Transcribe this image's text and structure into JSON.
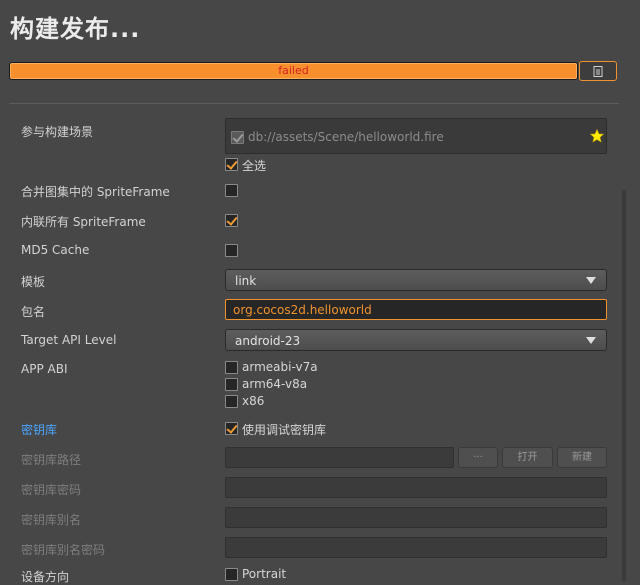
{
  "window": {
    "title": "构建发布..."
  },
  "progress": {
    "status_text": "failed",
    "value": 1.0
  },
  "log_button": {
    "icon": "document-icon"
  },
  "scenes": {
    "label": "参与构建场景",
    "items": [
      {
        "path": "db://assets/Scene/helloworld.fire",
        "checked": true,
        "start_scene": true
      }
    ],
    "select_all_label": "全选"
  },
  "merge_spriteframe": {
    "label": "合并图集中的 SpriteFrame",
    "checked": false
  },
  "inline_spriteframe": {
    "label": "内联所有 SpriteFrame",
    "checked": true
  },
  "md5_cache": {
    "label": "MD5 Cache",
    "checked": false
  },
  "template": {
    "label": "模板",
    "value": "link"
  },
  "package_name": {
    "label": "包名",
    "value": "org.cocos2d.helloworld"
  },
  "api_level": {
    "label": "Target API Level",
    "value": "android-23"
  },
  "app_abi": {
    "label": "APP ABI",
    "options": [
      {
        "name": "armeabi-v7a",
        "checked": false
      },
      {
        "name": "arm64-v8a",
        "checked": false
      },
      {
        "name": "x86",
        "checked": false
      }
    ]
  },
  "keystore": {
    "label": "密钥库",
    "use_debug_label": "使用调试密钥库",
    "use_debug_checked": true,
    "path_label": "密钥库路径",
    "path_value": "",
    "browse_label": "···",
    "open_label": "打开",
    "new_label": "新建",
    "password_label": "密钥库密码",
    "alias_label": "密钥库别名",
    "alias_password_label": "密钥库别名密码"
  },
  "orientation": {
    "label": "设备方向",
    "portrait_label": "Portrait",
    "portrait_checked": false
  },
  "colors": {
    "accent": "#f0932e",
    "error_text": "#d22323",
    "link": "#4aa4ff",
    "background": "#474747"
  }
}
